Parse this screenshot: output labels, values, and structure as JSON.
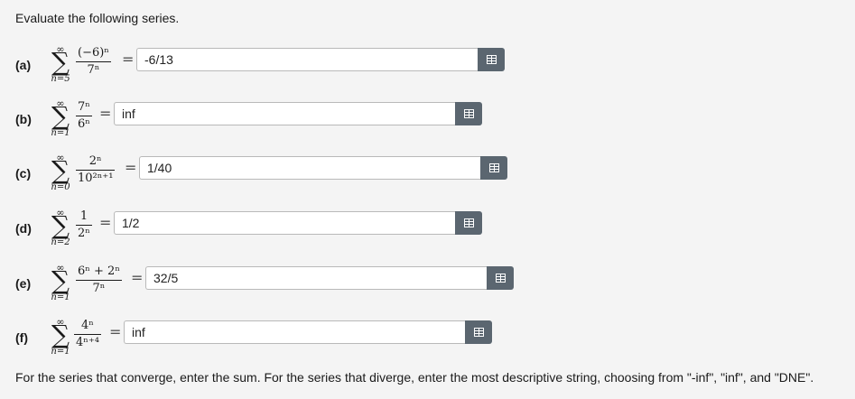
{
  "instructions": "Evaluate the following series.",
  "footer": "For the series that converge, enter the sum. For the series that diverge, enter the most descriptive string, choosing from \"-inf\", \"inf\", and \"DNE\".",
  "problems": [
    {
      "label": "(a)",
      "upper": "∞",
      "index": "n=5",
      "numerator": "(−6)ⁿ",
      "denominator": "7ⁿ",
      "answer": "-6/13",
      "icon": "grid-icon"
    },
    {
      "label": "(b)",
      "upper": "∞",
      "index": "n=1",
      "numerator": "7ⁿ",
      "denominator": "6ⁿ",
      "answer": "inf",
      "icon": "grid-icon"
    },
    {
      "label": "(c)",
      "upper": "∞",
      "index": "n=0",
      "numerator": "2ⁿ",
      "denominator": "10²ⁿ⁺¹",
      "answer": "1/40",
      "icon": "grid-icon"
    },
    {
      "label": "(d)",
      "upper": "∞",
      "index": "n=2",
      "numerator": "1",
      "denominator": "2ⁿ",
      "answer": "1/2",
      "icon": "grid-icon"
    },
    {
      "label": "(e)",
      "upper": "∞",
      "index": "n=1",
      "numerator": "6ⁿ + 2ⁿ",
      "denominator": "7ⁿ",
      "answer": "32/5",
      "icon": "grid-icon"
    },
    {
      "label": "(f)",
      "upper": "∞",
      "index": "n=1",
      "numerator": "4ⁿ",
      "denominator": "4ⁿ⁺⁴",
      "answer": "inf",
      "icon": "grid-icon"
    }
  ]
}
